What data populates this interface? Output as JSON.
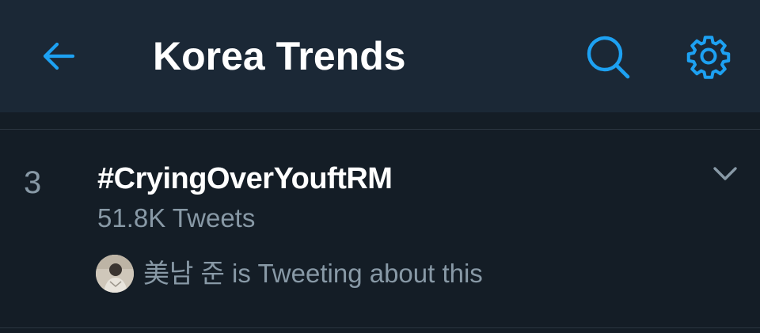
{
  "header": {
    "title": "Korea Trends",
    "back_icon": "arrow-left-icon",
    "search_icon": "search-icon",
    "settings_icon": "gear-icon"
  },
  "trend": {
    "rank": "3",
    "name": "#CryingOverYouftRM",
    "tweet_count": "51.8K Tweets",
    "menu_icon": "chevron-down-icon",
    "tweeting": {
      "user": "美남 준",
      "text": "美남 준 is Tweeting about this"
    }
  },
  "colors": {
    "header_bg": "#1b2836",
    "page_bg": "#141d26",
    "accent": "#1da1f2",
    "secondary_text": "#8899a6",
    "primary_text": "#ffffff"
  }
}
